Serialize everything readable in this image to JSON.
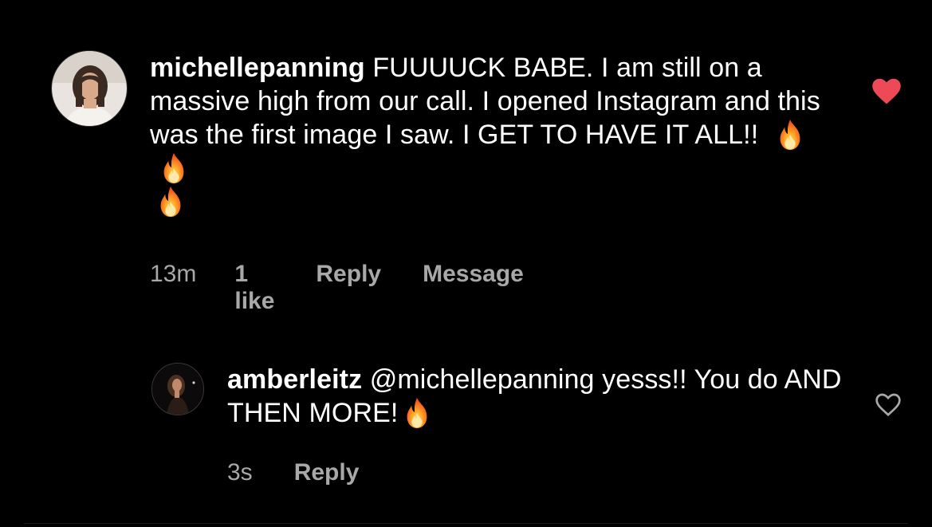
{
  "comments": [
    {
      "username": "michellepanning",
      "text": "FUUUUCK BABE. I am still on a massive high from our call. I opened Instagram and this was the first image I saw. I GET TO HAVE IT ALL!!",
      "emoji": "fire-icon x3",
      "time": "13m",
      "likes": "1 like",
      "reply_label": "Reply",
      "message_label": "Message",
      "liked": true,
      "heart_color": "#ed4956"
    },
    {
      "username": "amberleitz",
      "text": "@michellepanning yesss!! You do AND THEN MORE!",
      "emoji": "fire-icon x1",
      "time": "3s",
      "reply_label": "Reply",
      "liked": false
    }
  ],
  "colors": {
    "background": "#000000",
    "text": "#ffffff",
    "meta": "#a8a8a8",
    "like": "#ed4956"
  }
}
